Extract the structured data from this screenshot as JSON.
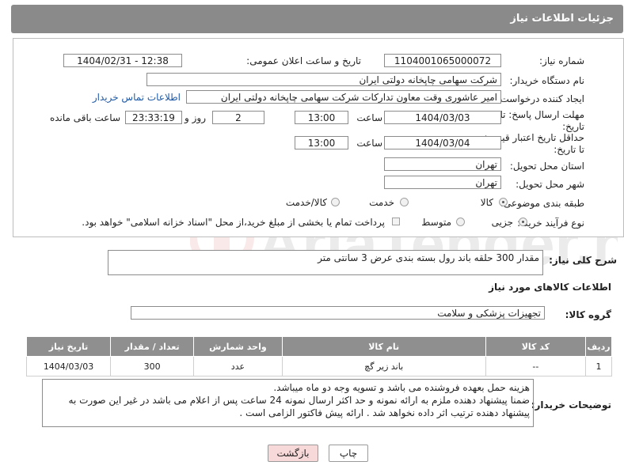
{
  "header": {
    "title": "جزئیات اطلاعات نیاز"
  },
  "form": {
    "need_number_label": "شماره نیاز:",
    "need_number": "1104001065000072",
    "announce_label": "تاریخ و ساعت اعلان عمومی:",
    "announce_value": "1404/02/31 - 12:38",
    "buyer_label": "نام دستگاه خریدار:",
    "buyer_value": "شرکت سهامی چاپخانه دولتی ایران",
    "creator_label": "ایجاد کننده درخواست:",
    "creator_value": "امیر عاشوری وقت معاون تدارکات شرکت سهامی چاپخانه دولتی ایران",
    "contact_link": "اطلاعات تماس خریدار",
    "deadline_label_1": "مهلت ارسال پاسخ: تا",
    "deadline_label_2": "تاریخ:",
    "deadline_date": "1404/03/03",
    "time_label": "ساعت",
    "deadline_time": "13:00",
    "days_value": "2",
    "days_label": "روز و",
    "remaining_time": "23:33:19",
    "remaining_label": "ساعت باقی مانده",
    "validity_label_1": "حداقل تاریخ اعتبار قیمت:",
    "validity_label_2": "تا تاریخ:",
    "validity_date": "1404/03/04",
    "validity_time": "13:00",
    "province_label": "استان محل تحویل:",
    "province_value": "تهران",
    "city_label": "شهر محل تحویل:",
    "city_value": "تهران",
    "category_label": "طبقه بندی موضوعی:",
    "category_options": [
      "کالا",
      "خدمت",
      "کالا/خدمت"
    ],
    "category_selected": "کالا",
    "process_label": "نوع فرآیند خرید :",
    "process_options": [
      "جزیی",
      "متوسط"
    ],
    "process_selected": "جزیی",
    "payment_note": "پرداخت تمام یا بخشی از مبلغ خرید،از محل \"اسناد خزانه اسلامی\" خواهد بود."
  },
  "description": {
    "label": "شرح کلی نیاز:",
    "value": "مقدار 300 حلقه باند رول بسته بندی عرض 3 سانتی متر"
  },
  "goods_section": {
    "title": "اطلاعات کالاهای مورد نیاز",
    "group_label": "گروه کالا:",
    "group_value": "تجهیزات پزشکی و سلامت"
  },
  "table": {
    "headers": [
      "ردیف",
      "کد کالا",
      "نام کالا",
      "واحد شمارش",
      "تعداد / مقدار",
      "تاریخ نیاز"
    ],
    "rows": [
      [
        "1",
        "--",
        "باند زیر گچ",
        "عدد",
        "300",
        "1404/03/03"
      ]
    ]
  },
  "buyer_notes": {
    "label": "توضیحات خریدار:",
    "lines": [
      "هزینه حمل بعهده فروشنده می باشد و تسویه وجه دو ماه میباشد.",
      "ضمنا پیشنهاد دهنده ملزم به ارائه نمونه و  حد اکثر ارسال نمونه 24 ساعت پس از اعلام می باشد در غیر این صورت به",
      "پیشنهاد دهنده ترتیب  اثر داده نخواهد شد . ارائه پیش فاکتور الزامی است ."
    ]
  },
  "buttons": {
    "print": "چاپ",
    "back": "بازگشت"
  },
  "watermark": {
    "text": "AriaTender.neT"
  },
  "colors": {
    "header_bg": "#8a8a8a",
    "link": "#1e5aa8",
    "back_btn_bg": "#f8d9d9"
  }
}
